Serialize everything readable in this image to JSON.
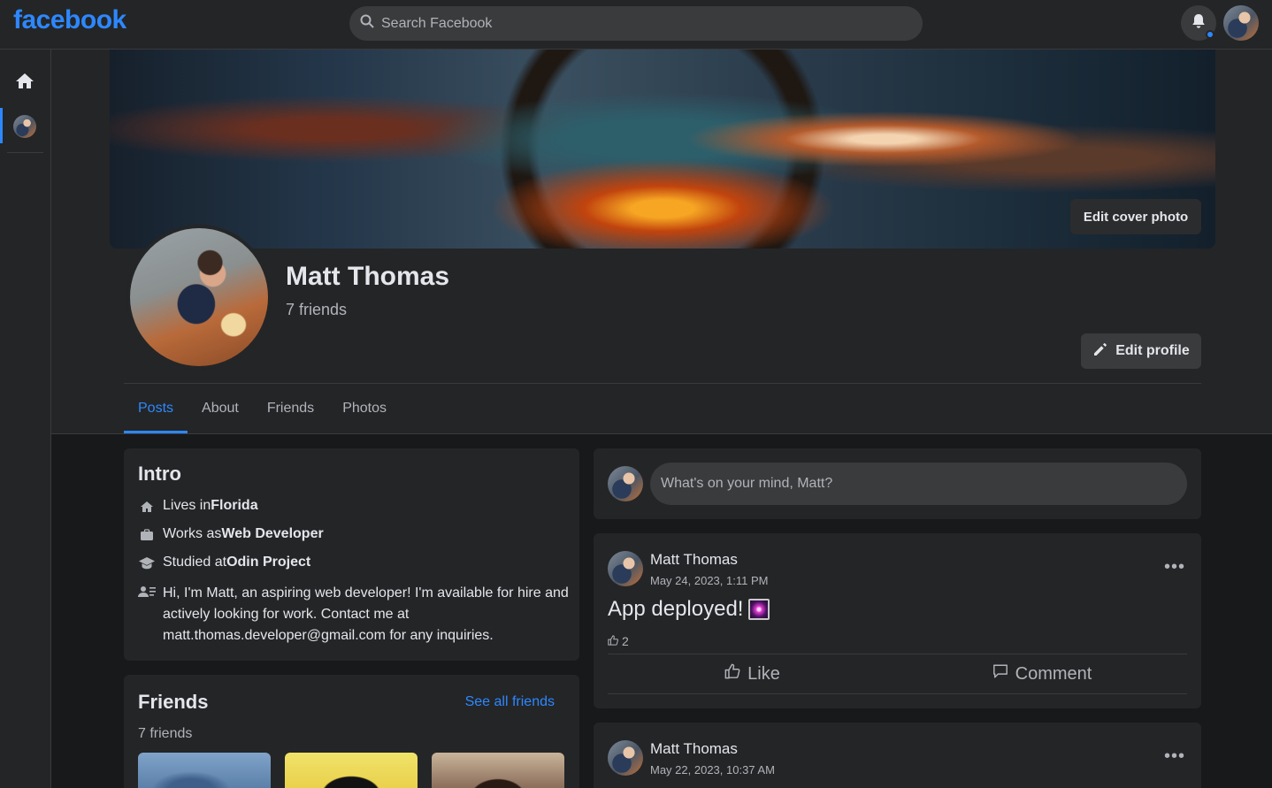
{
  "topbar": {
    "logo": "facebook",
    "search_placeholder": "Search Facebook"
  },
  "profile": {
    "name": "Matt Thomas",
    "friends_count": "7 friends",
    "edit_cover_label": "Edit cover photo",
    "edit_profile_label": "Edit profile"
  },
  "tabs": [
    {
      "label": "Posts",
      "active": true
    },
    {
      "label": "About",
      "active": false
    },
    {
      "label": "Friends",
      "active": false
    },
    {
      "label": "Photos",
      "active": false
    }
  ],
  "intro": {
    "title": "Intro",
    "lives_prefix": "Lives in ",
    "lives_value": "Florida",
    "works_prefix": "Works as ",
    "works_value": "Web Developer",
    "studied_prefix": "Studied at ",
    "studied_value": "Odin Project",
    "bio": "Hi, I'm Matt, an aspiring web developer! I'm available for hire and actively looking for work. Contact me at matt.thomas.developer@gmail.com for any inquiries."
  },
  "friends_card": {
    "title": "Friends",
    "see_all": "See all friends",
    "count": "7 friends"
  },
  "composer": {
    "placeholder": "What's on your mind, Matt?"
  },
  "posts": [
    {
      "author": "Matt Thomas",
      "date": "May 24, 2023, 1:11 PM",
      "text": "App deployed!",
      "likes": "2",
      "like_label": "Like",
      "comment_label": "Comment"
    },
    {
      "author": "Matt Thomas",
      "date": "May 22, 2023, 10:37 AM"
    }
  ],
  "colors": {
    "accent": "#2d88ff",
    "background": "#18191a",
    "surface": "#242526",
    "text": "#e4e6eb",
    "muted": "#b0b3b8"
  }
}
